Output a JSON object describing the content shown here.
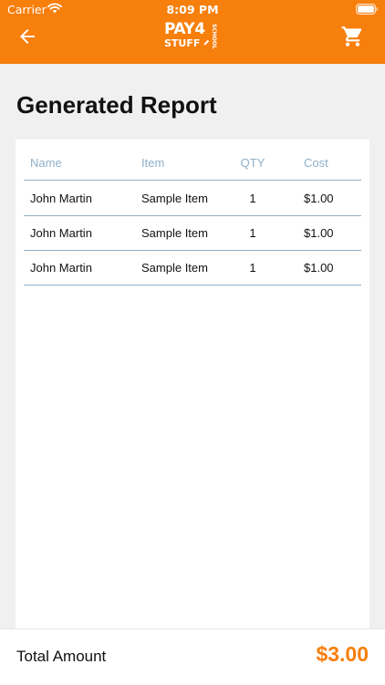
{
  "status_bar": {
    "carrier": "Carrier",
    "time": "8:09 PM"
  },
  "header": {
    "logo": {
      "line1": "PAY4",
      "line2": "STUFF",
      "side": "SCHOOL"
    },
    "back_icon": "arrow-left-icon",
    "cart_icon": "shopping-cart-icon",
    "background_color": "#f77f0c"
  },
  "page": {
    "title": "Generated Report"
  },
  "table": {
    "columns": [
      "Name",
      "Item",
      "QTY",
      "Cost"
    ],
    "rows": [
      {
        "name": "John Martin",
        "item": "Sample Item",
        "qty": "1",
        "cost": "$1.00"
      },
      {
        "name": "John Martin",
        "item": "Sample Item",
        "qty": "1",
        "cost": "$1.00"
      },
      {
        "name": "John Martin",
        "item": "Sample Item",
        "qty": "1",
        "cost": "$1.00"
      }
    ]
  },
  "footer": {
    "total_label": "Total Amount",
    "total_value": "$3.00",
    "accent_color": "#f77f0c"
  }
}
